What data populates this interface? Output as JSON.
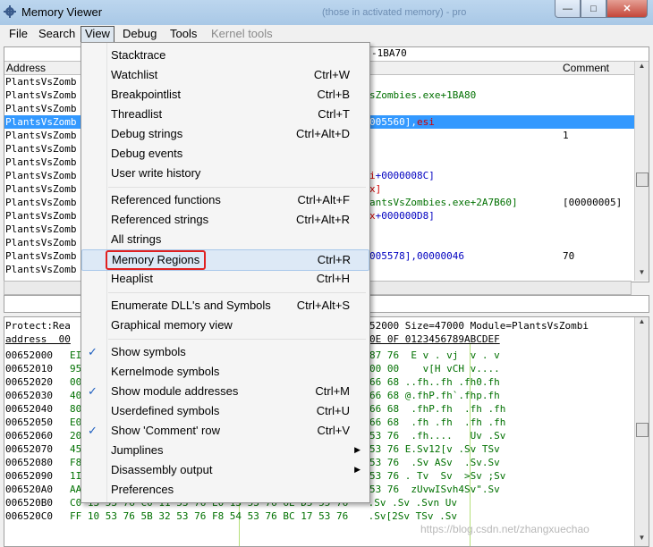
{
  "window": {
    "title": "Memory Viewer",
    "background_title": "(those in activated memory) - pro",
    "btn_min": "—",
    "btn_max": "□",
    "btn_close": "✕"
  },
  "menubar": {
    "file": "File",
    "search": "Search",
    "view": "View",
    "debug": "Debug",
    "tools": "Tools",
    "kernel_tools": "Kernel tools"
  },
  "disassembler": {
    "address_visible": "-1BA70",
    "headers": {
      "address": "Address",
      "comment": "Comment"
    },
    "address_prefix": "PlantsVsZomb",
    "rows": [
      {
        "addr": "PlantsVsZomb",
        "mid": "",
        "mid_color": "",
        "mid2": "",
        "mid2_color": "",
        "comment": ""
      },
      {
        "addr": "PlantsVsZomb",
        "mid": "sZombies.exe+1BA80",
        "mid_color": "green",
        "mid2": "",
        "mid2_color": "",
        "comment": ""
      },
      {
        "addr": "PlantsVsZomb",
        "mid": "",
        "mid_color": "",
        "mid2": "",
        "mid2_color": "",
        "comment": ""
      },
      {
        "addr": "PlantsVsZomb",
        "mid": "005560],",
        "mid_color": "sel",
        "mid2": "esi",
        "mid2_color": "red",
        "comment": "",
        "selected": true
      },
      {
        "addr": "PlantsVsZomb",
        "mid": "",
        "mid_color": "",
        "mid2": "",
        "mid2_color": "",
        "comment": "1"
      },
      {
        "addr": "PlantsVsZomb",
        "mid": "",
        "mid_color": "",
        "mid2": "",
        "mid2_color": "",
        "comment": ""
      },
      {
        "addr": "PlantsVsZomb",
        "mid": "",
        "mid_color": "",
        "mid2": "",
        "mid2_color": "",
        "comment": ""
      },
      {
        "addr": "PlantsVsZomb",
        "mid": "i",
        "mid_color": "red",
        "mid2": "+0000008C]",
        "mid2_color": "blue",
        "comment": ""
      },
      {
        "addr": "PlantsVsZomb",
        "mid": "x]",
        "mid_color": "red",
        "mid2": "",
        "mid2_color": "",
        "comment": ""
      },
      {
        "addr": "PlantsVsZomb",
        "mid": "antsVsZombies.exe+2A7B60]",
        "mid_color": "green",
        "mid2": "",
        "mid2_color": "",
        "comment": "[00000005]"
      },
      {
        "addr": "PlantsVsZomb",
        "mid": "x",
        "mid_color": "red",
        "mid2": "+000000D8]",
        "mid2_color": "blue",
        "comment": ""
      },
      {
        "addr": "PlantsVsZomb",
        "mid": "",
        "mid_color": "",
        "mid2": "",
        "mid2_color": "",
        "comment": ""
      },
      {
        "addr": "PlantsVsZomb",
        "mid": "",
        "mid_color": "",
        "mid2": "",
        "mid2_color": "",
        "comment": ""
      },
      {
        "addr": "PlantsVsZomb",
        "mid": "005578],00000046",
        "mid_color": "blue",
        "mid2": "",
        "mid2_color": "",
        "comment": "70"
      },
      {
        "addr": "PlantsVsZomb",
        "mid": "",
        "mid_color": "",
        "mid2": "",
        "mid2_color": "",
        "comment": ""
      }
    ]
  },
  "hexview": {
    "info_left": "Protect:Rea",
    "info_right": "52000 Size=47000 Module=PlantsVsZombi",
    "header_left": "address  00",
    "header_right": "0E 0F 0123456789ABCDEF",
    "rows": [
      {
        "addr": "00652000",
        "left": "EI",
        "right": "87 76  E v . vj  v . v"
      },
      {
        "addr": "00652010",
        "left": "95",
        "right": "00 00    v[H vCH v...."
      },
      {
        "addr": "00652020",
        "left": "00",
        "right": "66 68 ..fh..fh .fh0.fh"
      },
      {
        "addr": "00652030",
        "left": "40",
        "right": "66 68 @.fhP.fh`.fhp.fh"
      },
      {
        "addr": "00652040",
        "left": "80",
        "right": "66 68  .fhP.fh  .fh .fh"
      },
      {
        "addr": "00652050",
        "left": "E0",
        "right": "66 68  .fh .fh  .fh .fh"
      },
      {
        "addr": "00652060",
        "left": "20",
        "right": "53 76  .fh....   Uv .Sv"
      },
      {
        "addr": "00652070",
        "left": "45",
        "right": "53 76 E.Sv12[v .Sv TSv"
      },
      {
        "addr": "00652080",
        "left": "F8",
        "right": "53 76  .Sv ASv  .Sv.Sv"
      },
      {
        "addr": "00652090",
        "left": "1I",
        "right": "53 76 . Tv  Sv  >Sv ;Sv"
      },
      {
        "addr": "006520A0",
        "left": "AA",
        "right": "53 76  zUvwISvh4Sv\".Sv"
      },
      {
        "addr": "006520B0",
        "left": "C0 13 53 76 C0 11 53 76 E0 13 53 76 6E D5 55 76",
        "right": " .Sv .Sv .Svn Uv"
      },
      {
        "addr": "006520C0",
        "left": "FF 10 53 76 5B 32 53 76 F8 54 53 76 BC 17 53 76",
        "right": " .Sv[2Sv TSv .Sv"
      }
    ]
  },
  "view_menu": {
    "items": [
      {
        "label": "Stacktrace",
        "shortcut": "",
        "check": false,
        "submenu": false
      },
      {
        "label": "Watchlist",
        "shortcut": "Ctrl+W",
        "check": false,
        "submenu": false
      },
      {
        "label": "Breakpointlist",
        "shortcut": "Ctrl+B",
        "check": false,
        "submenu": false
      },
      {
        "label": "Threadlist",
        "shortcut": "Ctrl+T",
        "check": false,
        "submenu": false
      },
      {
        "label": "Debug strings",
        "shortcut": "Ctrl+Alt+D",
        "check": false,
        "submenu": false
      },
      {
        "label": "Debug events",
        "shortcut": "",
        "check": false,
        "submenu": false
      },
      {
        "label": "User write history",
        "shortcut": "",
        "check": false,
        "submenu": false
      },
      {
        "separator": true
      },
      {
        "label": "Referenced functions",
        "shortcut": "Ctrl+Alt+F",
        "check": false,
        "submenu": false
      },
      {
        "label": "Referenced strings",
        "shortcut": "Ctrl+Alt+R",
        "check": false,
        "submenu": false
      },
      {
        "label": "All strings",
        "shortcut": "",
        "check": false,
        "submenu": false
      },
      {
        "label": "Memory Regions",
        "shortcut": "Ctrl+R",
        "check": false,
        "submenu": false,
        "highlight": true
      },
      {
        "label": "Heaplist",
        "shortcut": "Ctrl+H",
        "check": false,
        "submenu": false
      },
      {
        "separator": true
      },
      {
        "label": "Enumerate DLL's and Symbols",
        "shortcut": "Ctrl+Alt+S",
        "check": false,
        "submenu": false
      },
      {
        "label": "Graphical memory view",
        "shortcut": "",
        "check": false,
        "submenu": false
      },
      {
        "separator": true
      },
      {
        "label": "Show symbols",
        "shortcut": "",
        "check": true,
        "submenu": false
      },
      {
        "label": "Kernelmode symbols",
        "shortcut": "",
        "check": false,
        "submenu": false
      },
      {
        "label": "Show module addresses",
        "shortcut": "Ctrl+M",
        "check": true,
        "submenu": false
      },
      {
        "label": "Userdefined symbols",
        "shortcut": "Ctrl+U",
        "check": false,
        "submenu": false
      },
      {
        "label": "Show 'Comment' row",
        "shortcut": "Ctrl+V",
        "check": true,
        "submenu": false
      },
      {
        "label": "Jumplines",
        "shortcut": "",
        "check": false,
        "submenu": true
      },
      {
        "label": "Disassembly output",
        "shortcut": "",
        "check": false,
        "submenu": true
      },
      {
        "label": "Preferences",
        "shortcut": "",
        "check": false,
        "submenu": false
      }
    ]
  },
  "icons": {
    "checkmark": "✓",
    "submenu_arrow": "▶",
    "app": "gear-icon"
  },
  "colors": {
    "selection": "#3399ff",
    "highlight_box": "#e02020",
    "symbol_green": "#007000",
    "register_red": "#d00000"
  },
  "watermark": "https://blog.csdn.net/zhangxuechao"
}
